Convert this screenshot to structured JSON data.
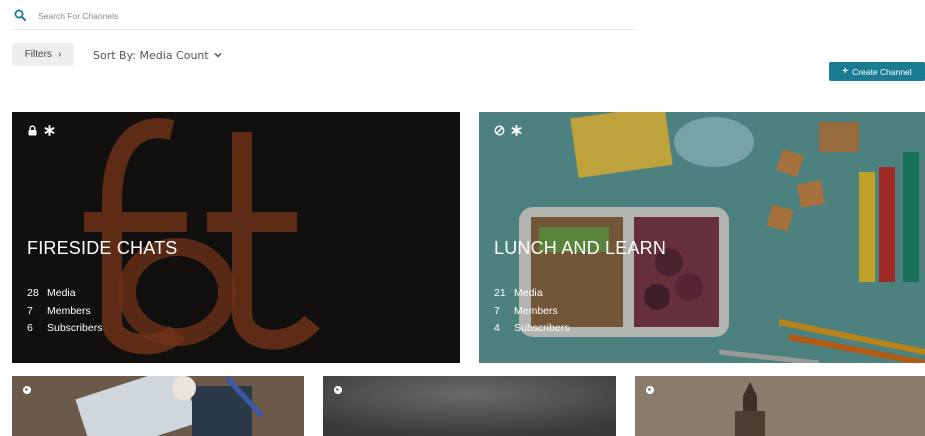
{
  "search": {
    "placeholder": "Search For Channels",
    "icon": "search-icon"
  },
  "toolbar": {
    "filters_label": "Filters",
    "sort_label": "Sort By: Media Count",
    "create_label": "Create Channel",
    "accent_color": "#1a7c93"
  },
  "channels": [
    {
      "title": "FIRESIDE CHATS",
      "icons": [
        "lock-icon",
        "asterisk-icon"
      ],
      "stats": [
        {
          "num": "28",
          "label": "Media"
        },
        {
          "num": "7",
          "label": "Members"
        },
        {
          "num": "6",
          "label": "Subscribers"
        }
      ]
    },
    {
      "title": "LUNCH AND LEARN",
      "icons": [
        "no-entry-icon",
        "asterisk-icon"
      ],
      "stats": [
        {
          "num": "21",
          "label": "Media"
        },
        {
          "num": "7",
          "label": "Members"
        },
        {
          "num": "4",
          "label": "Subscribers"
        }
      ]
    },
    {
      "icons": [
        "globe-icon"
      ]
    },
    {
      "icons": [
        "globe-icon"
      ]
    },
    {
      "icons": [
        "globe-icon"
      ]
    }
  ]
}
